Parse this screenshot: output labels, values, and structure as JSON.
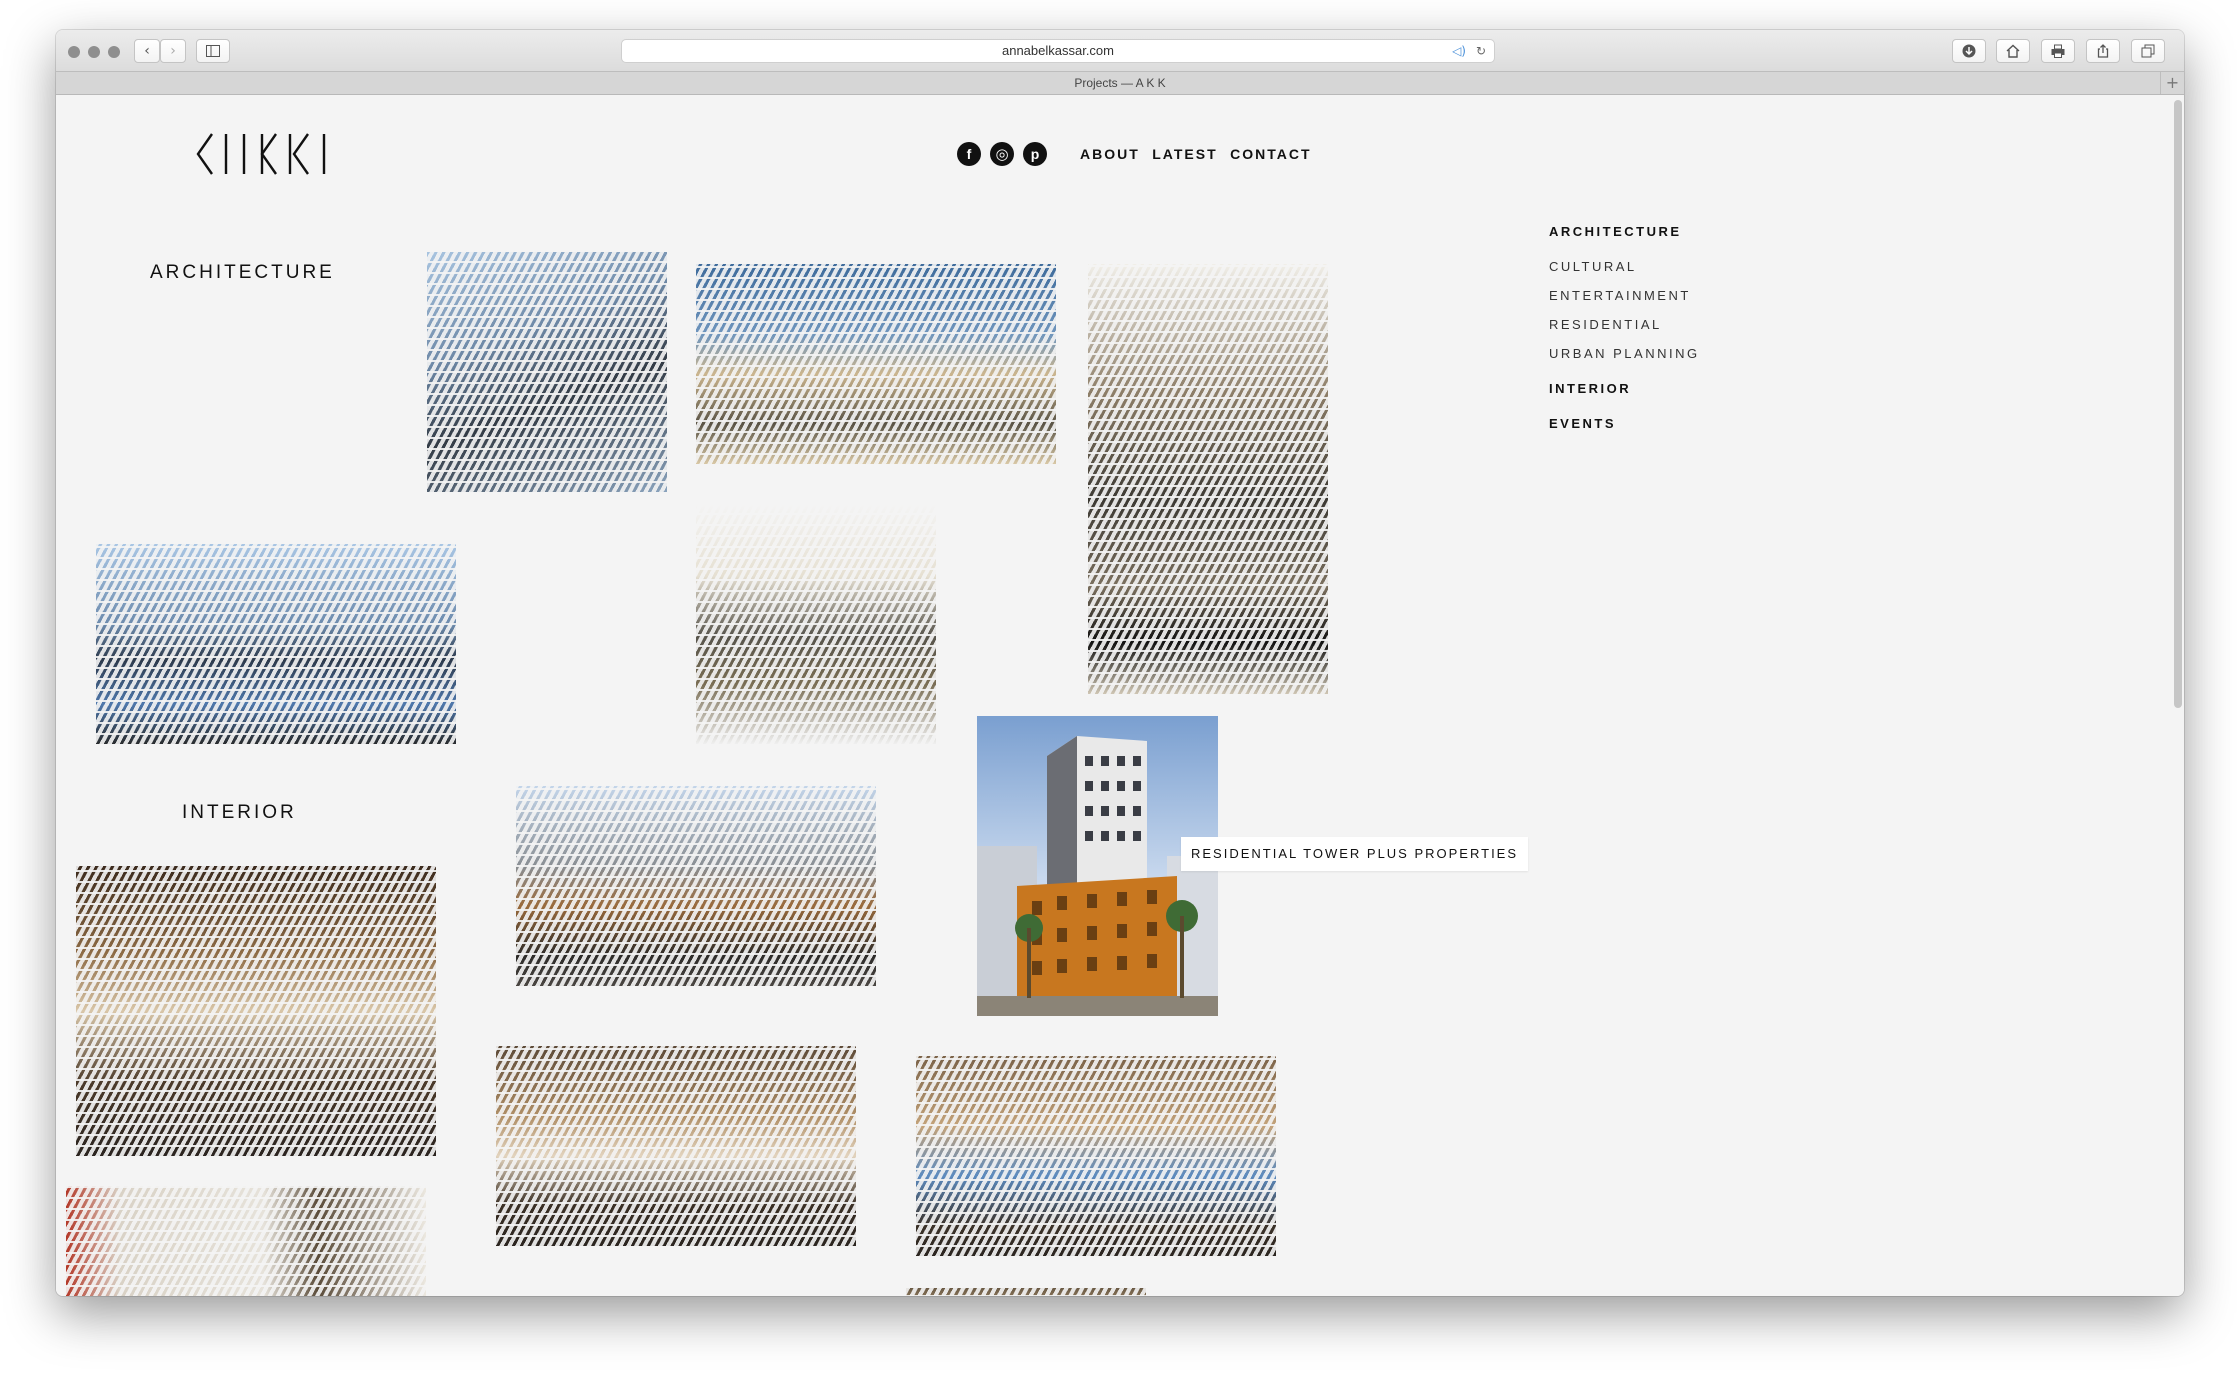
{
  "browser": {
    "url": "annabelkassar.com",
    "tab_title": "Projects — A K K"
  },
  "header": {
    "logo_text": "AKK",
    "social": {
      "facebook": "f",
      "instagram": "◎",
      "pinterest": "p"
    },
    "nav": [
      "ABOUT",
      "LATEST",
      "CONTACT"
    ]
  },
  "sections": {
    "architecture": "ARCHITECTURE",
    "interior": "INTERIOR"
  },
  "sidebar": {
    "architecture": "ARCHITECTURE",
    "subs": [
      "CULTURAL",
      "ENTERTAINMENT",
      "RESIDENTIAL",
      "URBAN PLANNING"
    ],
    "interior": "INTERIOR",
    "events": "EVENTS"
  },
  "hovered_project": "RESIDENTIAL TOWER PLUS PROPERTIES",
  "icons": {
    "back": "chevron-left-icon",
    "forward": "chevron-right-icon",
    "sidebar": "sidebar-icon",
    "download": "download-icon",
    "home": "home-icon",
    "print": "print-icon",
    "share": "share-icon",
    "tabs": "tabs-icon",
    "reload": "reload-icon",
    "audio": "speaker-icon"
  }
}
